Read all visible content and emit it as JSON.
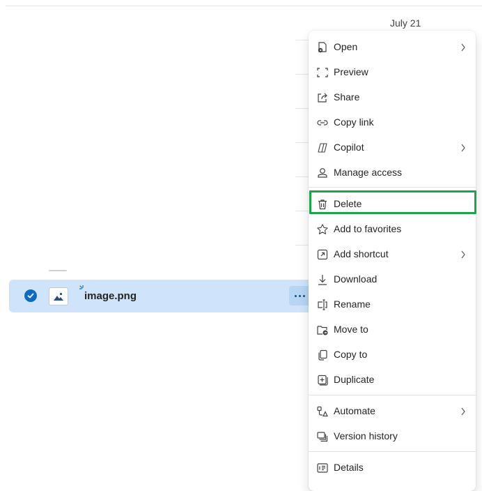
{
  "list": {
    "date_header": "July 21",
    "selected_file": {
      "name": "image.png",
      "selected": true
    }
  },
  "context_menu": {
    "items": [
      {
        "id": "open",
        "label": "Open",
        "icon": "open-icon",
        "submenu": true
      },
      {
        "id": "preview",
        "label": "Preview",
        "icon": "preview-icon",
        "submenu": false
      },
      {
        "id": "share",
        "label": "Share",
        "icon": "share-icon",
        "submenu": false
      },
      {
        "id": "copy-link",
        "label": "Copy link",
        "icon": "link-icon",
        "submenu": false
      },
      {
        "id": "copilot",
        "label": "Copilot",
        "icon": "copilot-icon",
        "submenu": true
      },
      {
        "id": "manage-access",
        "label": "Manage access",
        "icon": "person-icon",
        "submenu": false
      },
      {
        "id": "delete",
        "label": "Delete",
        "icon": "trash-icon",
        "submenu": false,
        "highlighted": true
      },
      {
        "id": "add-to-favorites",
        "label": "Add to favorites",
        "icon": "star-icon",
        "submenu": false
      },
      {
        "id": "add-shortcut",
        "label": "Add shortcut",
        "icon": "shortcut-icon",
        "submenu": true
      },
      {
        "id": "download",
        "label": "Download",
        "icon": "download-icon",
        "submenu": false
      },
      {
        "id": "rename",
        "label": "Rename",
        "icon": "rename-icon",
        "submenu": false
      },
      {
        "id": "move-to",
        "label": "Move to",
        "icon": "move-folder-icon",
        "submenu": false
      },
      {
        "id": "copy-to",
        "label": "Copy to",
        "icon": "copy-icon",
        "submenu": false
      },
      {
        "id": "duplicate",
        "label": "Duplicate",
        "icon": "duplicate-icon",
        "submenu": false
      },
      {
        "id": "automate",
        "label": "Automate",
        "icon": "automate-icon",
        "submenu": true
      },
      {
        "id": "version-history",
        "label": "Version history",
        "icon": "history-icon",
        "submenu": false
      },
      {
        "id": "details",
        "label": "Details",
        "icon": "details-icon",
        "submenu": false
      }
    ]
  },
  "colors": {
    "selection_bg": "#cfe4fa",
    "accent": "#0f6cbd",
    "highlight_border": "#1fa34a"
  }
}
